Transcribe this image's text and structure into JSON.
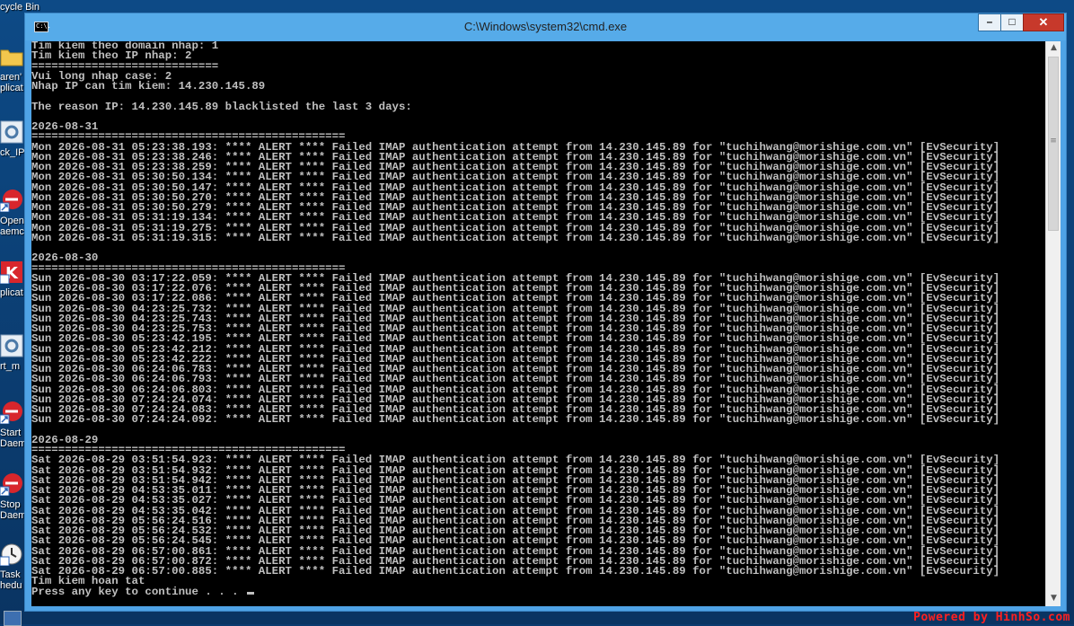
{
  "desktop": {
    "recycle_bin_label": "cycle Bin",
    "icons": [
      {
        "label": "aren'\nplicat",
        "icon": "folder-icon"
      },
      {
        "label": "ck_IP",
        "icon": "gear-shortcut-icon"
      },
      {
        "label": "Open\naemc",
        "icon": "app-shortcut-icon"
      },
      {
        "label": "plicat",
        "icon": "k-app-icon"
      },
      {
        "label": "rt_m",
        "icon": "gear-shortcut-icon"
      },
      {
        "label": "Start\nDaem",
        "icon": "app-shortcut-icon"
      },
      {
        "label": "Stop\nDaem",
        "icon": "app-shortcut-icon"
      },
      {
        "label": "Task\nhedu",
        "icon": "clock-icon"
      }
    ],
    "watermark": "Powered by HinhSo.com"
  },
  "window": {
    "title": "C:\\Windows\\system32\\cmd.exe",
    "icon_text": "C:\\.",
    "buttons": {
      "minimize": "–",
      "maximize": "□",
      "close": "✕"
    }
  },
  "console": {
    "lines": [
      "Tim kiem theo domain nhap: 1",
      "Tim kiem theo IP nhap: 2",
      "============================",
      "Vui long nhap case: 2",
      "Nhap IP can tim kiem: 14.230.145.89",
      "",
      "The reason IP: 14.230.145.89 blacklisted the last 3 days:",
      "",
      "2026-08-31",
      "===============================================",
      "Mon 2026-08-31 05:23:38.193: **** ALERT **** Failed IMAP authentication attempt from 14.230.145.89 for \"tuchihwang@morishige.com.vn\" [EvSecurity]",
      "Mon 2026-08-31 05:23:38.246: **** ALERT **** Failed IMAP authentication attempt from 14.230.145.89 for \"tuchihwang@morishige.com.vn\" [EvSecurity]",
      "Mon 2026-08-31 05:23:38.259: **** ALERT **** Failed IMAP authentication attempt from 14.230.145.89 for \"tuchihwang@morishige.com.vn\" [EvSecurity]",
      "Mon 2026-08-31 05:30:50.134: **** ALERT **** Failed IMAP authentication attempt from 14.230.145.89 for \"tuchihwang@morishige.com.vn\" [EvSecurity]",
      "Mon 2026-08-31 05:30:50.147: **** ALERT **** Failed IMAP authentication attempt from 14.230.145.89 for \"tuchihwang@morishige.com.vn\" [EvSecurity]",
      "Mon 2026-08-31 05:30:50.270: **** ALERT **** Failed IMAP authentication attempt from 14.230.145.89 for \"tuchihwang@morishige.com.vn\" [EvSecurity]",
      "Mon 2026-08-31 05:30:50.279: **** ALERT **** Failed IMAP authentication attempt from 14.230.145.89 for \"tuchihwang@morishige.com.vn\" [EvSecurity]",
      "Mon 2026-08-31 05:31:19.134: **** ALERT **** Failed IMAP authentication attempt from 14.230.145.89 for \"tuchihwang@morishige.com.vn\" [EvSecurity]",
      "Mon 2026-08-31 05:31:19.275: **** ALERT **** Failed IMAP authentication attempt from 14.230.145.89 for \"tuchihwang@morishige.com.vn\" [EvSecurity]",
      "Mon 2026-08-31 05:31:19.315: **** ALERT **** Failed IMAP authentication attempt from 14.230.145.89 for \"tuchihwang@morishige.com.vn\" [EvSecurity]",
      "",
      "2026-08-30",
      "===============================================",
      "Sun 2026-08-30 03:17:22.059: **** ALERT **** Failed IMAP authentication attempt from 14.230.145.89 for \"tuchihwang@morishige.com.vn\" [EvSecurity]",
      "Sun 2026-08-30 03:17:22.076: **** ALERT **** Failed IMAP authentication attempt from 14.230.145.89 for \"tuchihwang@morishige.com.vn\" [EvSecurity]",
      "Sun 2026-08-30 03:17:22.086: **** ALERT **** Failed IMAP authentication attempt from 14.230.145.89 for \"tuchihwang@morishige.com.vn\" [EvSecurity]",
      "Sun 2026-08-30 04:23:25.732: **** ALERT **** Failed IMAP authentication attempt from 14.230.145.89 for \"tuchihwang@morishige.com.vn\" [EvSecurity]",
      "Sun 2026-08-30 04:23:25.743: **** ALERT **** Failed IMAP authentication attempt from 14.230.145.89 for \"tuchihwang@morishige.com.vn\" [EvSecurity]",
      "Sun 2026-08-30 04:23:25.753: **** ALERT **** Failed IMAP authentication attempt from 14.230.145.89 for \"tuchihwang@morishige.com.vn\" [EvSecurity]",
      "Sun 2026-08-30 05:23:42.195: **** ALERT **** Failed IMAP authentication attempt from 14.230.145.89 for \"tuchihwang@morishige.com.vn\" [EvSecurity]",
      "Sun 2026-08-30 05:23:42.212: **** ALERT **** Failed IMAP authentication attempt from 14.230.145.89 for \"tuchihwang@morishige.com.vn\" [EvSecurity]",
      "Sun 2026-08-30 05:23:42.222: **** ALERT **** Failed IMAP authentication attempt from 14.230.145.89 for \"tuchihwang@morishige.com.vn\" [EvSecurity]",
      "Sun 2026-08-30 06:24:06.783: **** ALERT **** Failed IMAP authentication attempt from 14.230.145.89 for \"tuchihwang@morishige.com.vn\" [EvSecurity]",
      "Sun 2026-08-30 06:24:06.793: **** ALERT **** Failed IMAP authentication attempt from 14.230.145.89 for \"tuchihwang@morishige.com.vn\" [EvSecurity]",
      "Sun 2026-08-30 06:24:06.803: **** ALERT **** Failed IMAP authentication attempt from 14.230.145.89 for \"tuchihwang@morishige.com.vn\" [EvSecurity]",
      "Sun 2026-08-30 07:24:24.074: **** ALERT **** Failed IMAP authentication attempt from 14.230.145.89 for \"tuchihwang@morishige.com.vn\" [EvSecurity]",
      "Sun 2026-08-30 07:24:24.083: **** ALERT **** Failed IMAP authentication attempt from 14.230.145.89 for \"tuchihwang@morishige.com.vn\" [EvSecurity]",
      "Sun 2026-08-30 07:24:24.092: **** ALERT **** Failed IMAP authentication attempt from 14.230.145.89 for \"tuchihwang@morishige.com.vn\" [EvSecurity]",
      "",
      "2026-08-29",
      "===============================================",
      "Sat 2026-08-29 03:51:54.923: **** ALERT **** Failed IMAP authentication attempt from 14.230.145.89 for \"tuchihwang@morishige.com.vn\" [EvSecurity]",
      "Sat 2026-08-29 03:51:54.932: **** ALERT **** Failed IMAP authentication attempt from 14.230.145.89 for \"tuchihwang@morishige.com.vn\" [EvSecurity]",
      "Sat 2026-08-29 03:51:54.942: **** ALERT **** Failed IMAP authentication attempt from 14.230.145.89 for \"tuchihwang@morishige.com.vn\" [EvSecurity]",
      "Sat 2026-08-29 04:53:35.011: **** ALERT **** Failed IMAP authentication attempt from 14.230.145.89 for \"tuchihwang@morishige.com.vn\" [EvSecurity]",
      "Sat 2026-08-29 04:53:35.027: **** ALERT **** Failed IMAP authentication attempt from 14.230.145.89 for \"tuchihwang@morishige.com.vn\" [EvSecurity]",
      "Sat 2026-08-29 04:53:35.042: **** ALERT **** Failed IMAP authentication attempt from 14.230.145.89 for \"tuchihwang@morishige.com.vn\" [EvSecurity]",
      "Sat 2026-08-29 05:56:24.516: **** ALERT **** Failed IMAP authentication attempt from 14.230.145.89 for \"tuchihwang@morishige.com.vn\" [EvSecurity]",
      "Sat 2026-08-29 05:56:24.532: **** ALERT **** Failed IMAP authentication attempt from 14.230.145.89 for \"tuchihwang@morishige.com.vn\" [EvSecurity]",
      "Sat 2026-08-29 05:56:24.545: **** ALERT **** Failed IMAP authentication attempt from 14.230.145.89 for \"tuchihwang@morishige.com.vn\" [EvSecurity]",
      "Sat 2026-08-29 06:57:00.861: **** ALERT **** Failed IMAP authentication attempt from 14.230.145.89 for \"tuchihwang@morishige.com.vn\" [EvSecurity]",
      "Sat 2026-08-29 06:57:00.872: **** ALERT **** Failed IMAP authentication attempt from 14.230.145.89 for \"tuchihwang@morishige.com.vn\" [EvSecurity]",
      "Sat 2026-08-29 06:57:00.885: **** ALERT **** Failed IMAP authentication attempt from 14.230.145.89 for \"tuchihwang@morishige.com.vn\" [EvSecurity]",
      "Tim kiem hoan tat",
      "Press any key to continue . . . "
    ]
  },
  "scrollbar": {
    "up": "▲",
    "down": "▼",
    "grip": "≡"
  }
}
